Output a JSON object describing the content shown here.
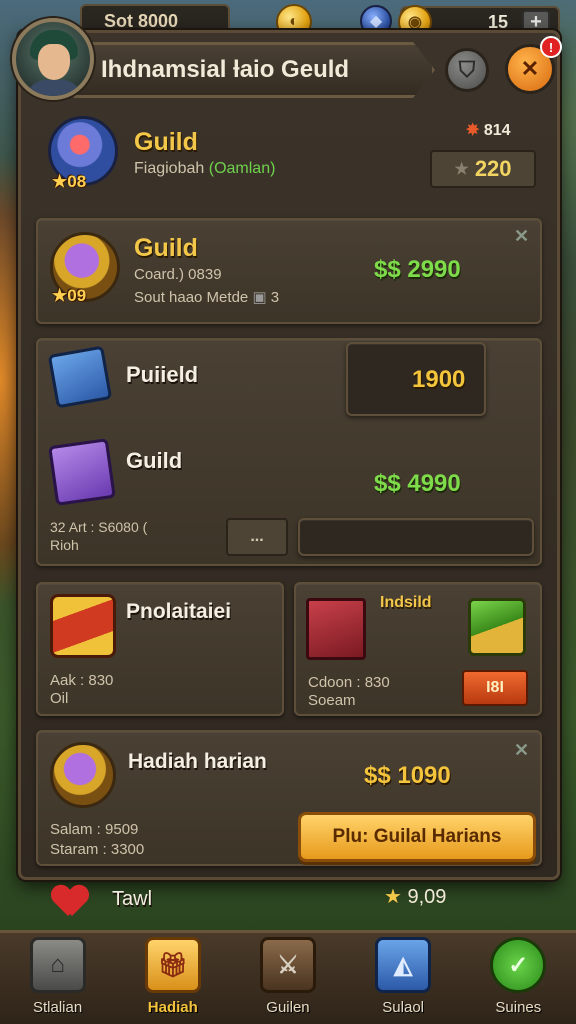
{
  "topbar": {
    "resource_text": "Sot 8000",
    "counter_value": "15",
    "plus_label": "+"
  },
  "header": {
    "title": "Ihdnamsial ƚaio Geuld",
    "notification_count": "!"
  },
  "guild_header": {
    "title": "Guild",
    "subtitle_prefix": "Fiagiobah",
    "subtitle_green": "(Oamlan)",
    "badge_num": "08",
    "top_right_stat": "814",
    "button_value": "220"
  },
  "card1": {
    "title": "Guild",
    "line1": "Coard.) 0839",
    "line2": "Sout haao Metde",
    "line2_suffix": "3",
    "badge_num": "09",
    "price": "$$ 2990"
  },
  "card2": {
    "title": "Puiield",
    "price_gold": "1900"
  },
  "card3": {
    "title": "Guild",
    "stat1": "32 Art : S6080 (",
    "stat2": "Rioh",
    "dots_label": "...",
    "price": "$$ 4990"
  },
  "card4": {
    "title": "Pnolaitaiei",
    "stat1": "Aak : 830",
    "stat2": "Oil"
  },
  "card5": {
    "title": "Indsild",
    "stat1": "Cdoon : 830",
    "stat2": "Soeam",
    "button_label": "I8I"
  },
  "card6": {
    "title": "Hadiah harian",
    "stat1": "Salam : 9509",
    "stat2": "Staram : 3300",
    "price": "$$ 1090",
    "button_label": "Plu: Guilal Harians"
  },
  "bottom_stats": {
    "left_label": "Tawl",
    "right_value": "9,09"
  },
  "nav": [
    {
      "label": "Stlalian",
      "active": false
    },
    {
      "label": "Hadiah",
      "active": true
    },
    {
      "label": "Guilen",
      "active": false
    },
    {
      "label": "Sulaol",
      "active": false
    },
    {
      "label": "Suines",
      "active": false
    }
  ],
  "colors": {
    "gold_text": "#f2c74a",
    "green_price": "#7edc4a",
    "accent_orange": "#e79a1c"
  }
}
